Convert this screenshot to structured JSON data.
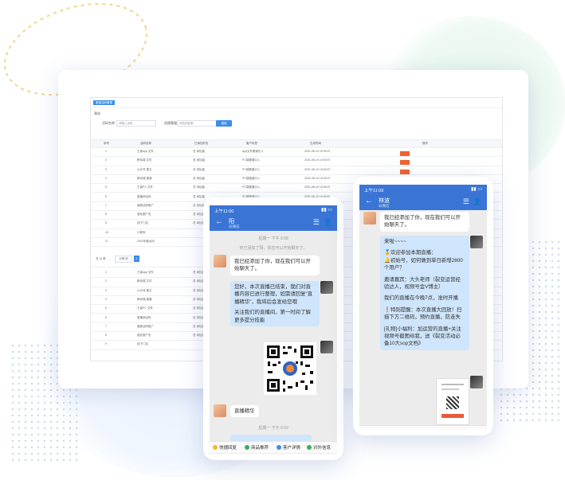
{
  "colors": {
    "accent": "#3a8ee6",
    "header_blue": "#3a75d6",
    "bubble_out": "#cfe5fb",
    "op_orange": "#f5a623",
    "op_red": "#f0612f"
  },
  "admin": {
    "tag": "渠道活码管理",
    "filter_title": "筛选",
    "filter_label_1": "活码名称",
    "filter_input_1": "请输入活码",
    "filter_label_2": "创建客服",
    "filter_input_2": "请选择客服",
    "search_button": "搜索",
    "columns": [
      "序号",
      "活码名称",
      "已添加好友",
      "客户标签",
      "生成时间",
      "操作"
    ],
    "rows": [
      {
        "no": "1",
        "name": "王者app 文件",
        "count": "总 添加量",
        "tag": "app文件渠道引入",
        "time": "2021-06-10 10:00:07"
      },
      {
        "no": "2",
        "name": "移动端 文件",
        "count": "总 添加量",
        "tag": "PC端渠道引入",
        "time": "2021-06-10 10:00:07"
      },
      {
        "no": "3",
        "name": "公众号 推文",
        "count": "总 添加量",
        "tag": "PC端渠道引入",
        "time": "2021-06-10 10:00:07"
      },
      {
        "no": "4",
        "name": "移动端 渠道",
        "count": "总 添加量",
        "tag": "PC端渠道引入",
        "time": "2021-06-10 10:00:07"
      },
      {
        "no": "5",
        "name": "王者PC 文件",
        "count": "总 添加量",
        "tag": "PC端渠道引入",
        "time": "2021-06-10 10:00:07"
      },
      {
        "no": "6",
        "name": "直播间活码",
        "count": "总 添加量",
        "tag": "PC端渠道引入",
        "time": "2021-06-10 10:00:07"
      },
      {
        "no": "7",
        "name": "客服活码推广",
        "count": "总 添加量",
        "tag": "",
        "time": ""
      },
      {
        "no": "8",
        "name": "朋友圈广告",
        "count": "总 添加量",
        "tag": "",
        "time": ""
      },
      {
        "no": "9",
        "name": "线下门店",
        "count": "总 添加量",
        "tag": "",
        "time": ""
      },
      {
        "no": "10",
        "name": "小程序",
        "count": "",
        "tag": "",
        "time": ""
      },
      {
        "no": "11",
        "name": "2021年度活动",
        "count": "",
        "tag": "",
        "time": ""
      }
    ],
    "pager_label": "共 11 条",
    "pager_size": "10条/页",
    "pager_page": "1",
    "rows2": [
      {
        "no": "1",
        "name": "王者app 文件",
        "count": "总 添加量"
      },
      {
        "no": "2",
        "name": "移动端 文件",
        "count": "总 添加量"
      },
      {
        "no": "3",
        "name": "公众号 推文",
        "count": "总 添加量"
      },
      {
        "no": "4",
        "name": "移动端 渠道",
        "count": "总 添加量"
      },
      {
        "no": "5",
        "name": "王者PC 文件",
        "count": "总 添加量"
      },
      {
        "no": "6",
        "name": "直播间活码",
        "count": "总 添加量"
      },
      {
        "no": "7",
        "name": "客服活码推广",
        "count": "总 添加量"
      },
      {
        "no": "8",
        "name": "朋友圈广告",
        "count": "总 添加量"
      },
      {
        "no": "9",
        "name": "线下门店",
        "count": ""
      }
    ]
  },
  "phone_left": {
    "status_time": "上午11:00",
    "contact": "阳",
    "sub": "@微信",
    "sys_1": "星期一 下午 6:58",
    "sys_2": "你已添加了阳，现在可以开始聊天了。",
    "msg_1": "我已经添加了你，现在我们可以开始聊天了。",
    "msg_2": "您好，本次直播已结束，我们对直播内容已进行整理，如需请回复\"直播精华\"，我将后会发给您哦",
    "msg_3": "关注我们的直播间，第一时间了解更多提分技能",
    "msg_4": "直播精华",
    "sys_3": "星期一 下午 6:59",
    "bottom_items": [
      "快捷回复",
      "商品推荐",
      "客户详情",
      "对外信息"
    ]
  },
  "phone_right": {
    "status_time": "上午11:09",
    "contact": "林波",
    "sub": "@微信",
    "msg_1": "我已经添加了你，现在我们可以开始聊天了。",
    "msg_2_lines": [
      "来啦~~~~",
      "🏅欢迎参加本期直播：",
      "🔔初始号，如何做到单日新增2800个用户？",
      "邀请嘉宾：大头老师（裂变运营经验达人，视频号金V博主）",
      "我们的直播在今晚7点，准时开播",
      "❗特别提醒：本次直播大回放！扫描下方二维码，预约直播，防走失",
      "[礼物]小福利：加运营的直播+关注视频号截图给我，送《裂变活动必备10大sop文档》"
    ]
  }
}
